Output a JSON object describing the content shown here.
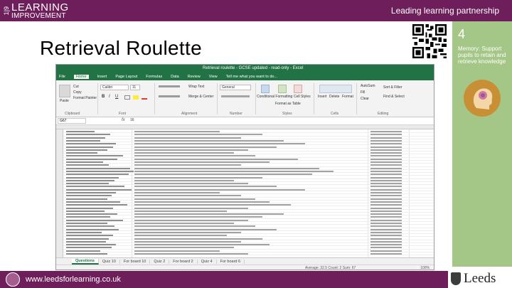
{
  "banner": {
    "logo_number": "1|9",
    "logo_line1": "LEARNING",
    "logo_line2": "IMPROVEMENT",
    "title": "Leading learning partnership"
  },
  "slide": {
    "title": "Retrieval Roulette"
  },
  "panel": {
    "number": "4",
    "text": "Memory: Support pupils to retain and retrieve knowledge",
    "icon": "head-with-brain-icon"
  },
  "excel": {
    "window_title": "Retrieval roulette - GCSE updated - read-only - Excel",
    "menu": [
      "File",
      "Home",
      "Insert",
      "Page Layout",
      "Formulas",
      "Data",
      "Review",
      "View",
      "Tell me what you want to do..."
    ],
    "active_menu": "Home",
    "ribbon": {
      "paste": "Paste",
      "cut": "Cut",
      "copy": "Copy",
      "format_painter": "Format Painter",
      "clipboard": "Clipboard",
      "font_name": "Calibri",
      "font_size": "11",
      "font": "Font",
      "wrap_text": "Wrap Text",
      "merge_center": "Merge & Center",
      "alignment": "Alignment",
      "number_format": "General",
      "number": "Number",
      "conditional_formatting": "Conditional Formatting",
      "format_as_table": "Format as Table",
      "cell_styles": "Cell Styles",
      "styles": "Styles",
      "insert": "Insert",
      "delete": "Delete",
      "format": "Format",
      "cells": "Cells",
      "autosum": "AutoSum",
      "fill": "Fill",
      "clear": "Clear",
      "sort_filter": "Sort & Filter",
      "find_select": "Find & Select",
      "editing": "Editing"
    },
    "name_box": "G67",
    "formula_symbol": "fx",
    "formula_value": "16",
    "sheet_tabs": [
      "Questions",
      "Quiz 10",
      "For board 10",
      "Quiz 2",
      "For board 2",
      "Quiz 4",
      "For board 6"
    ],
    "active_tab": "Questions",
    "status": "Average: 32.5   Count: 2   Sum: 67",
    "zoom": "100%"
  },
  "footer": {
    "url": "www.leedsforlearning.co.uk",
    "brand": "Leeds"
  },
  "colors": {
    "banner": "#6e1f5b",
    "panel": "#a4c686",
    "excel_green": "#217346"
  }
}
